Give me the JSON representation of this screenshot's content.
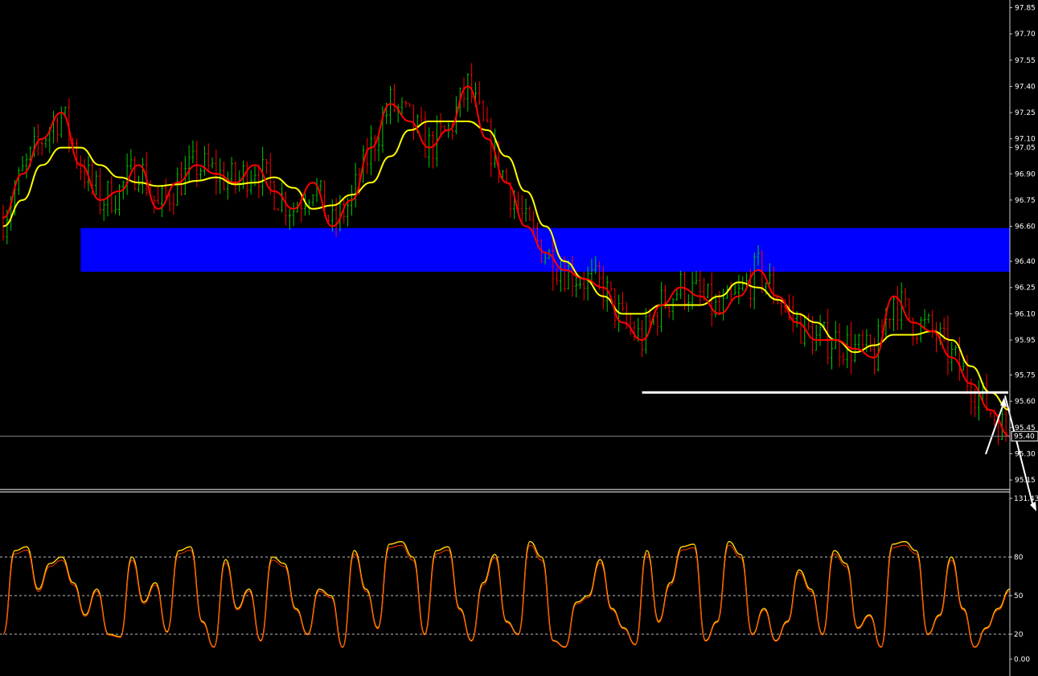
{
  "chart_data": [
    {
      "type": "line",
      "panel": "price",
      "y_ticks": [
        "97.85",
        "97.70",
        "97.55",
        "97.40",
        "97.25",
        "97.10",
        "97.05",
        "96.90",
        "96.75",
        "96.60",
        "96.40",
        "96.25",
        "96.10",
        "95.95",
        "95.75",
        "95.60",
        "95.45",
        "95.30",
        "95.15"
      ],
      "y_tick_values": [
        97.85,
        97.7,
        97.55,
        97.4,
        97.25,
        97.1,
        97.05,
        96.9,
        96.75,
        96.6,
        96.4,
        96.25,
        96.1,
        95.95,
        95.75,
        95.6,
        95.45,
        95.3,
        95.15
      ],
      "ylim": [
        95.1,
        97.88
      ],
      "current_price_label": "95.40",
      "current_price": 95.4,
      "bar_count": 260,
      "resistance_zone": {
        "from": 96.34,
        "to": 96.59,
        "start_bar": 20,
        "color": "#0000ff"
      },
      "support_line": {
        "value": 95.65,
        "start_bar": 165,
        "end_bar": 260,
        "color": "#ffffff"
      },
      "ma_fast": {
        "color": "#ff0000",
        "x": [
          0,
          5,
          10,
          15,
          20,
          25,
          30,
          35,
          40,
          45,
          50,
          55,
          60,
          65,
          70,
          75,
          80,
          85,
          90,
          95,
          100,
          105,
          110,
          115,
          120,
          125,
          130,
          135,
          140,
          145,
          150,
          155,
          160,
          165,
          170,
          175,
          180,
          185,
          190,
          195,
          200,
          205,
          210,
          215,
          220,
          225,
          230,
          235,
          240,
          245,
          250,
          255,
          260
        ],
        "values": [
          96.65,
          96.9,
          97.1,
          97.25,
          96.95,
          96.75,
          96.8,
          96.95,
          96.7,
          96.85,
          96.95,
          96.9,
          96.85,
          96.95,
          96.8,
          96.7,
          96.85,
          96.6,
          96.75,
          97.05,
          97.3,
          97.2,
          97.05,
          97.15,
          97.4,
          97.1,
          96.85,
          96.6,
          96.45,
          96.35,
          96.3,
          96.25,
          96.05,
          95.95,
          96.15,
          96.25,
          96.2,
          96.1,
          96.2,
          96.35,
          96.2,
          96.05,
          95.95,
          95.95,
          95.9,
          95.85,
          96.2,
          96.05,
          96.0,
          95.85,
          95.7,
          95.55,
          95.4
        ]
      },
      "ma_slow": {
        "color": "#ffff00",
        "x": [
          0,
          5,
          10,
          15,
          20,
          25,
          30,
          35,
          40,
          45,
          50,
          55,
          60,
          65,
          70,
          75,
          80,
          85,
          90,
          95,
          100,
          105,
          110,
          115,
          120,
          125,
          130,
          135,
          140,
          145,
          150,
          155,
          160,
          165,
          170,
          175,
          180,
          185,
          190,
          195,
          200,
          205,
          210,
          215,
          220,
          225,
          230,
          235,
          240,
          245,
          250,
          255,
          260
        ],
        "values": [
          96.6,
          96.75,
          96.95,
          97.05,
          97.05,
          96.95,
          96.88,
          96.85,
          96.83,
          96.84,
          96.86,
          96.88,
          96.84,
          96.85,
          96.88,
          96.82,
          96.7,
          96.72,
          96.78,
          96.85,
          97.0,
          97.15,
          97.2,
          97.2,
          97.2,
          97.15,
          97.0,
          96.8,
          96.6,
          96.4,
          96.3,
          96.2,
          96.1,
          96.1,
          96.15,
          96.15,
          96.15,
          96.2,
          96.28,
          96.25,
          96.18,
          96.1,
          96.05,
          95.95,
          95.88,
          95.92,
          95.98,
          95.98,
          96.0,
          95.95,
          95.8,
          95.65,
          95.55
        ]
      }
    },
    {
      "type": "line",
      "panel": "stochastic",
      "ylim": [
        0,
        100
      ],
      "y_ticks": [
        "131.43",
        "80",
        "50",
        "20",
        "0.00"
      ],
      "y_tick_values": [
        131.43,
        80,
        50,
        20,
        0
      ],
      "levels": [
        80,
        50,
        20
      ],
      "main_color": "#ff3300",
      "signal_color": "#ffcc00",
      "x": [
        0,
        3,
        6,
        9,
        12,
        15,
        18,
        21,
        24,
        27,
        30,
        33,
        36,
        39,
        42,
        45,
        48,
        51,
        54,
        57,
        60,
        63,
        66,
        69,
        72,
        75,
        78,
        81,
        84,
        87,
        90,
        93,
        96,
        99,
        102,
        105,
        108,
        111,
        114,
        117,
        120,
        123,
        126,
        129,
        132,
        135,
        138,
        141,
        144,
        147,
        150,
        153,
        156,
        159,
        162,
        165,
        168,
        171,
        174,
        177,
        180,
        183,
        186,
        189,
        192,
        195,
        198,
        201,
        204,
        207,
        210,
        213,
        216,
        219,
        222,
        225,
        228,
        231,
        234,
        237,
        240,
        243,
        246,
        249,
        252,
        255,
        258
      ],
      "values": [
        20,
        85,
        88,
        55,
        75,
        80,
        60,
        35,
        55,
        20,
        18,
        80,
        45,
        60,
        22,
        85,
        88,
        30,
        10,
        78,
        40,
        55,
        15,
        80,
        75,
        40,
        20,
        55,
        50,
        10,
        85,
        55,
        25,
        90,
        92,
        80,
        20,
        85,
        88,
        40,
        15,
        60,
        82,
        30,
        20,
        92,
        80,
        15,
        10,
        45,
        50,
        78,
        40,
        25,
        12,
        85,
        30,
        60,
        88,
        90,
        15,
        30,
        92,
        82,
        20,
        40,
        15,
        30,
        70,
        55,
        20,
        85,
        75,
        25,
        35,
        10,
        90,
        92,
        85,
        20,
        35,
        80,
        40,
        10,
        25,
        40,
        55
      ]
    }
  ]
}
